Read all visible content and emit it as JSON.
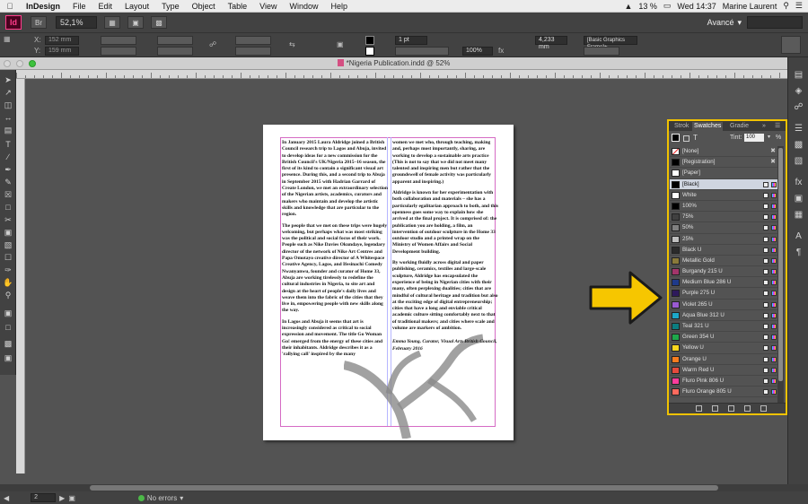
{
  "menubar": {
    "apple": "",
    "items": [
      "InDesign",
      "File",
      "Edit",
      "Layout",
      "Type",
      "Object",
      "Table",
      "View",
      "Window",
      "Help"
    ],
    "battery": "13 %",
    "clock": "Wed 14:37",
    "user": "Marine Laurent"
  },
  "appbar": {
    "logo": "Id",
    "zoom": "52,1%",
    "workspace": "Avancé"
  },
  "control": {
    "x_label": "X:",
    "x_value": "152 mm",
    "y_label": "Y:",
    "y_value": "159 mm",
    "stroke_weight": "1 pt",
    "percent": "100%",
    "dimension": "4,233 mm",
    "style": "[Basic Graphics Frame]+"
  },
  "document": {
    "tab_title": "*Nigeria Publication.indd @ 52%",
    "col1": [
      "In January 2015 Laura Aldridge joined a British Council research trip to Lagos and Abuja, invited to develop ideas for a new commission for the British Council's UK/Nigeria 2015–16 season, the first of its kind to contain a significant visual art presence. During this, and a second trip to Abuja in September 2015 with Hadrian Garrard of Create London, we met an extraordinary selection of the Nigerian artists, academics, curators and makers who maintain and develop the artistic skills and knowledge that are particular to the region.",
      "The people that we met on these trips were hugely welcoming, but perhaps what was most striking was the political and social focus of their work. People such as Nike Davies Okundaye, legendary director of the network of Nike Art Centres and Papa Omotayo creative director of A Whitespace Creative Agency, Lagos, and Ifesinachi Comedy Nwanyanwu, founder and curator of Home 33, Abuja are working tirelessly to redefine the cultural industries in Nigeria, to site art and design at the heart of people's daily lives and weave them into the fabric of the cities that they live in, empowering people with new skills along the way.",
      "In Lagos and Abuja it seems that art is increasingly considered as critical to social expression and movement. The title Go Woman Go! emerged from the energy of these cities and their inhabitants. Aldridge describes it as a 'rallying call' inspired by the many"
    ],
    "col2": [
      "women we met who, through teaching, making and, perhaps most importantly, sharing, are working to develop a sustainable arts practice (This is not to say that we did not meet many talented and inspiring men but rather that the groundswell of female activity was particularly apparent and inspiring.)",
      "Aldridge is known for her experimentation with both collaboration and materials – she has a particularly egalitarian approach to both, and this openness goes some way to explain how she arrived at the final project. It is comprised of: the publication you are holding, a film, an intervention of outdoor sculpture in the Home 33 outdoor studio and a printed wrap on the Ministry of Women Affairs and Social Development building.",
      "By working fluidly across digital and paper publishing, ceramics, textiles and large-scale sculpture, Aldridge has encapsulated the experience of being in Nigerian cities with their many, often perplexing dualities; cities that are mindful of cultural heritage and tradition but also at the exciting edge of digital entrepreneurship; cities that have a long and enviable critical academic culture sitting comfortably next to that of traditional makers; and cities where scale and volume are markers of ambition."
    ],
    "signature": "Emma Young, Curator, Visual Arts British Council, February 2016"
  },
  "status": {
    "page": "2",
    "errors": "No errors"
  },
  "swatches_panel": {
    "tabs": [
      "Strok",
      "Swatches",
      "Gradie"
    ],
    "tint_label": "Tint:",
    "tint_value": "100",
    "tint_unit": "%",
    "text_toggle": "T",
    "items": [
      {
        "name": "[None]",
        "color": "#ffffff",
        "mark": "x"
      },
      {
        "name": "[Registration]",
        "color": "#000000",
        "mark": "reg"
      },
      {
        "name": "[Paper]",
        "color": "#ffffff",
        "mark": ""
      },
      {
        "name": "[Black]",
        "color": "#000000",
        "mark": "lock",
        "selected": true
      },
      {
        "name": "White",
        "color": "#ffffff",
        "mark": "icons"
      },
      {
        "name": "100%",
        "color": "#000000",
        "mark": "icons"
      },
      {
        "name": "75%",
        "color": "#404040",
        "mark": "icons"
      },
      {
        "name": "50%",
        "color": "#808080",
        "mark": "icons"
      },
      {
        "name": "25%",
        "color": "#bfbfbf",
        "mark": "icons"
      },
      {
        "name": "Black U",
        "color": "#2b2b2b",
        "mark": "icons"
      },
      {
        "name": "Metallic Gold",
        "color": "#8a7a3a",
        "mark": "icons"
      },
      {
        "name": "Burgandy 215 U",
        "color": "#a3356a",
        "mark": "icons"
      },
      {
        "name": "Medium Blue 286 U",
        "color": "#1e3a8a",
        "mark": "icons"
      },
      {
        "name": "Purple 275 U",
        "color": "#2e1a5c",
        "mark": "icons"
      },
      {
        "name": "Violet 265 U",
        "color": "#9a5ad2",
        "mark": "icons"
      },
      {
        "name": "Aqua Blue 312 U",
        "color": "#1ca7c9",
        "mark": "icons"
      },
      {
        "name": "Teal 321 U",
        "color": "#0c7d80",
        "mark": "icons"
      },
      {
        "name": "Green 354 U",
        "color": "#1ea84b",
        "mark": "icons"
      },
      {
        "name": "Yellow U",
        "color": "#fcd71e",
        "mark": "icons"
      },
      {
        "name": "Orange U",
        "color": "#f77c1e",
        "mark": "icons"
      },
      {
        "name": "Warm Red U",
        "color": "#e54b3c",
        "mark": "icons"
      },
      {
        "name": "Fluro Pink 806 U",
        "color": "#ff3d9c",
        "mark": "icons"
      },
      {
        "name": "Fluro Orange 805 U",
        "color": "#ff6a5e",
        "mark": "icons"
      }
    ]
  },
  "colors": {
    "highlight": "#f1c200",
    "arrow": "#f6c600"
  }
}
